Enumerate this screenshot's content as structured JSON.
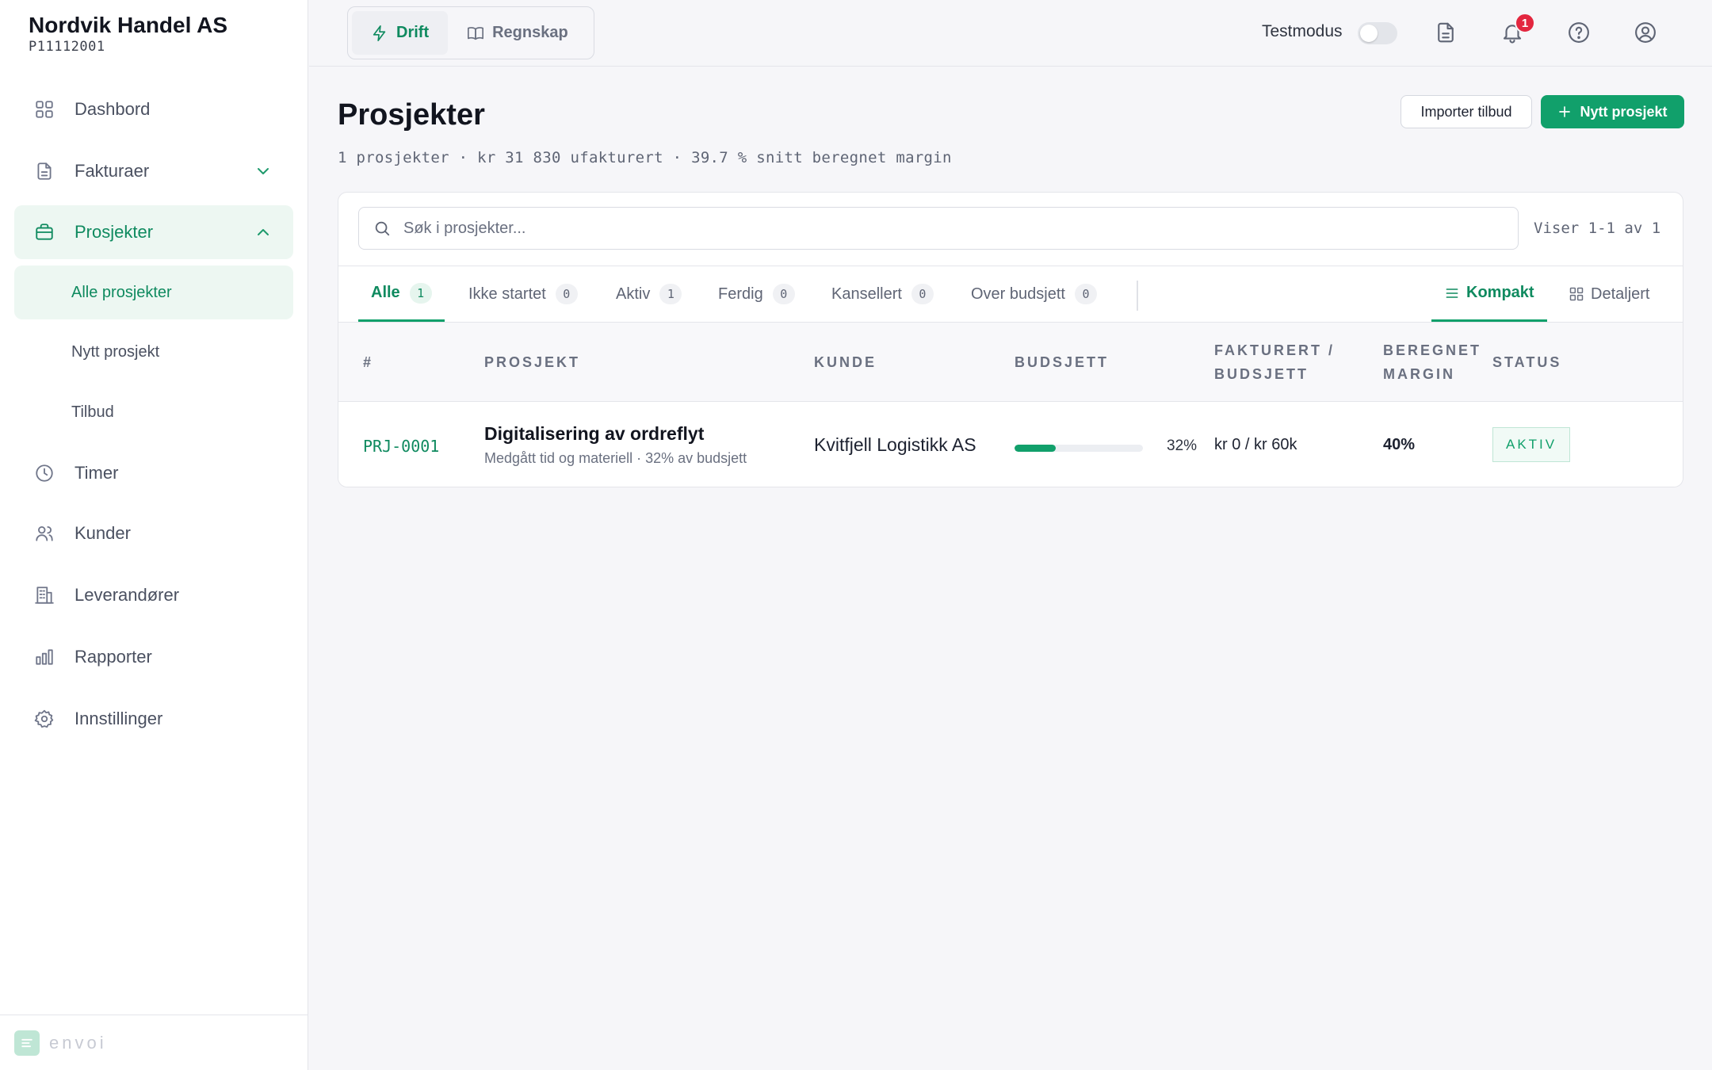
{
  "org": {
    "name": "Nordvik Handel AS",
    "id": "P11112001"
  },
  "nav": {
    "dashboard": "Dashbord",
    "invoices": "Fakturaer",
    "projects": "Prosjekter",
    "projects_sub": {
      "all": "Alle prosjekter",
      "new": "Nytt prosjekt",
      "quotes": "Tilbud"
    },
    "hours": "Timer",
    "customers": "Kunder",
    "suppliers": "Leverandører",
    "reports": "Rapporter",
    "settings": "Innstillinger"
  },
  "brand": "envoi",
  "topbar": {
    "modes": [
      "Drift",
      "Regnskap"
    ],
    "active_mode": "Drift",
    "test_mode_label": "Testmodus",
    "test_mode_on": false,
    "notification_count": "1"
  },
  "page": {
    "title": "Prosjekter",
    "summary": "1 prosjekter · kr 31 830 ufakturert · 39.7 % snitt beregnet margin",
    "import_button": "Importer tilbud",
    "new_button": "Nytt prosjekt"
  },
  "search": {
    "placeholder": "Søk i prosjekter...",
    "value": ""
  },
  "result_count": "Viser 1-1 av 1",
  "tabs": [
    {
      "label": "Alle",
      "count": "1",
      "active": true
    },
    {
      "label": "Ikke startet",
      "count": "0",
      "active": false
    },
    {
      "label": "Aktiv",
      "count": "1",
      "active": false
    },
    {
      "label": "Ferdig",
      "count": "0",
      "active": false
    },
    {
      "label": "Kansellert",
      "count": "0",
      "active": false
    },
    {
      "label": "Over budsjett",
      "count": "0",
      "active": false
    }
  ],
  "views": {
    "compact": "Kompakt",
    "detailed": "Detaljert",
    "active": "Kompakt"
  },
  "table": {
    "headers": {
      "id": "#",
      "project": "PROSJEKT",
      "customer": "KUNDE",
      "budget": "BUDSJETT",
      "invoiced_1": "FAKTURERT /",
      "invoiced_2": "BUDSJETT",
      "margin_1": "BEREGNET",
      "margin_2": "MARGIN",
      "status": "STATUS"
    },
    "rows": [
      {
        "id": "PRJ-0001",
        "name": "Digitalisering av ordreflyt",
        "subtitle": "Medgått tid og materiell · 32% av budsjett",
        "customer": "Kvitfjell Logistikk AS",
        "budget_used_pct": 32,
        "budget_used_label": "32%",
        "invoiced": "kr 0 / kr 60k",
        "margin": "40%",
        "status": "AKTIV"
      }
    ]
  },
  "colors": {
    "accent": "#11a06b",
    "accent_text": "#0f8a5f",
    "badge_red": "#e3263f"
  }
}
